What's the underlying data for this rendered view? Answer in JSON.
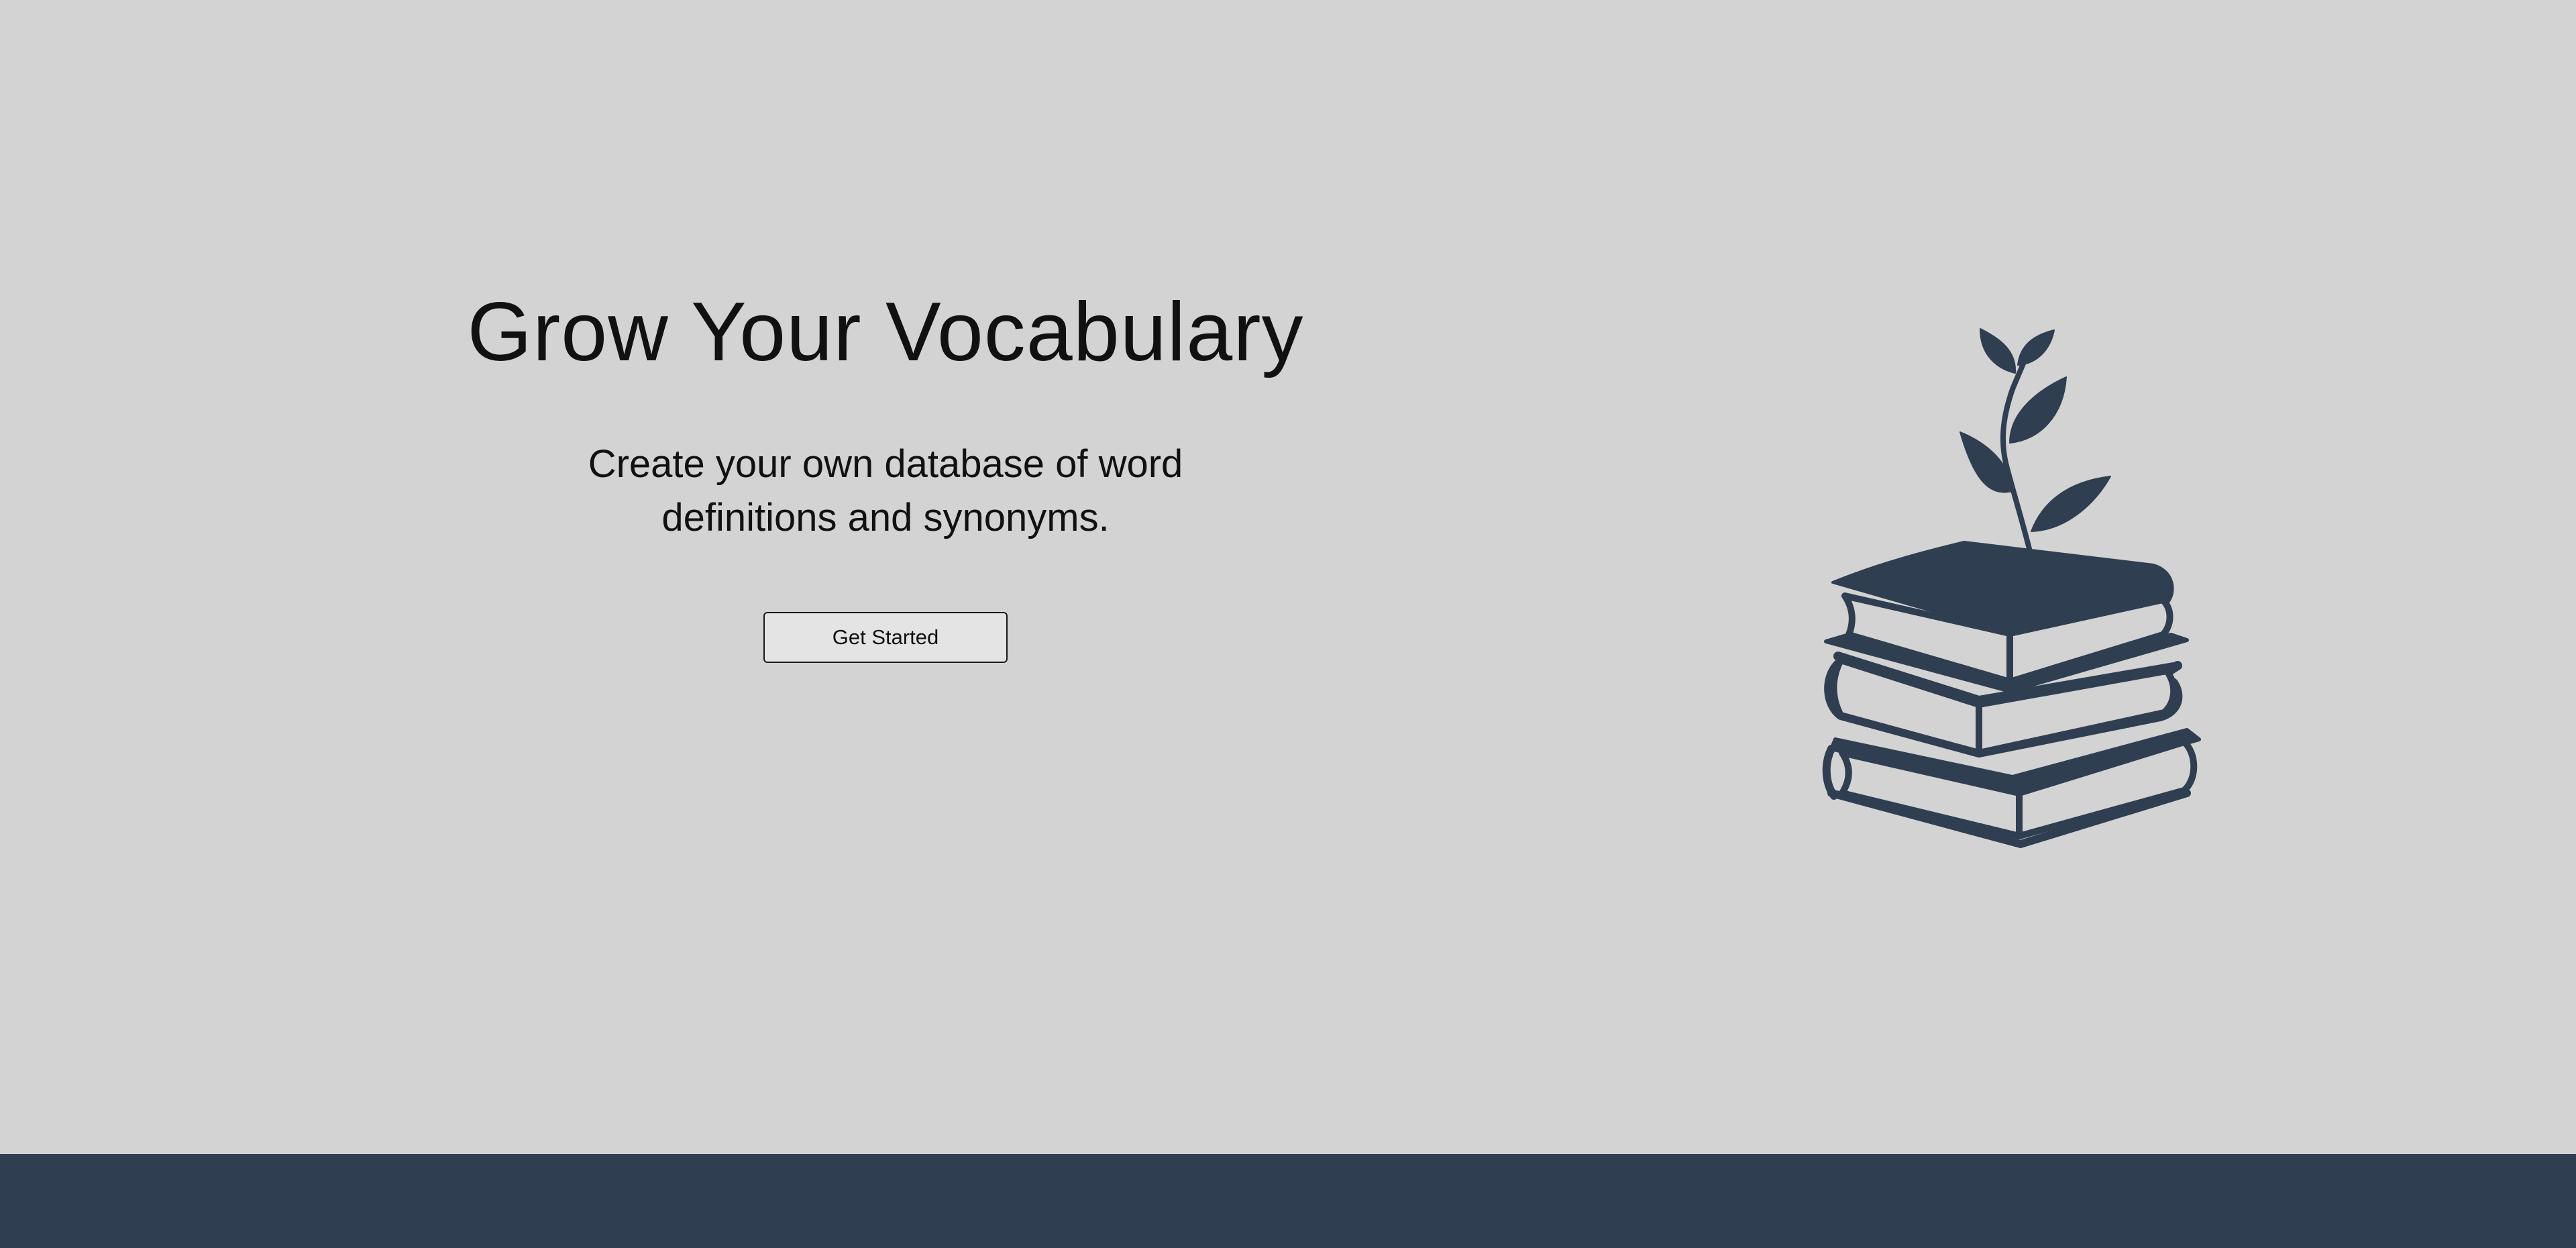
{
  "hero": {
    "title": "Grow Your Vocabulary",
    "subtitle": "Create your own database of word definitions and synonyms.",
    "cta_label": "Get Started"
  },
  "illustration": {
    "icon": "books-with-sprout-icon"
  },
  "colors": {
    "background": "#d3d3d3",
    "accent": "#2f3e50",
    "button_bg": "#e4e4e4",
    "text": "#111111"
  }
}
